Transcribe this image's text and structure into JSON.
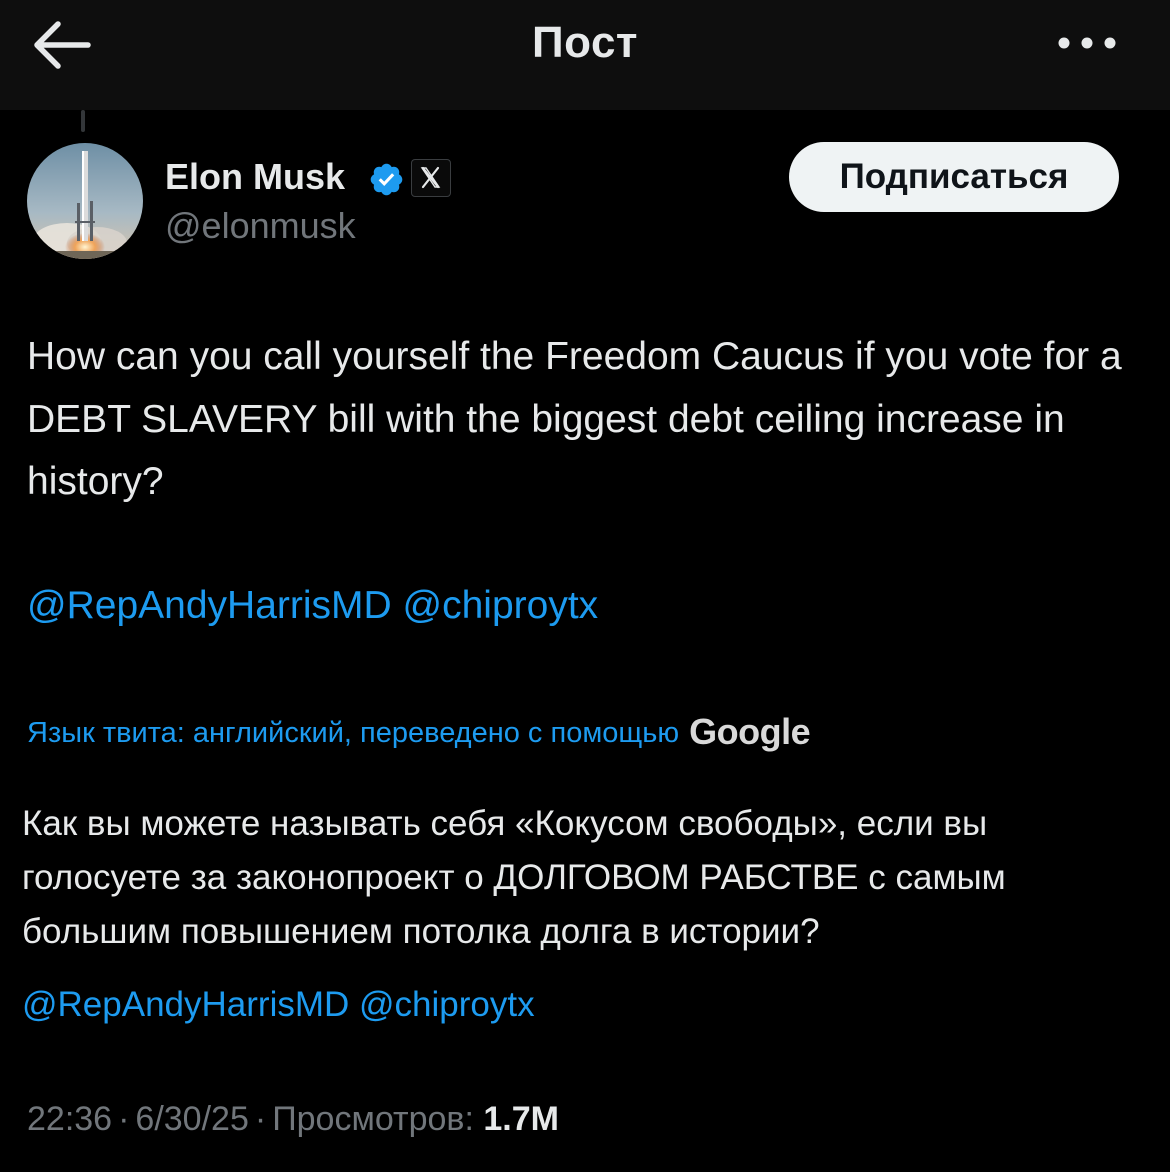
{
  "header": {
    "title": "Пост",
    "back_icon": "arrow-left-icon",
    "more_icon": "more-horizontal-icon"
  },
  "author": {
    "name": "Elon Musk",
    "handle": "@elonmusk",
    "verified": true,
    "affiliate_badge": "x-logo-icon",
    "avatar": "rocket-launch-avatar"
  },
  "follow_button": {
    "label": "Подписаться"
  },
  "tweet": {
    "text": "How can you call yourself the Freedom Caucus if you vote for a DEBT SLAVERY bill with the biggest debt ceiling increase in history?",
    "mentions": [
      "@RepAndyHarrisMD",
      "@chiproytx"
    ]
  },
  "translation": {
    "label": "Язык твита: английский, переведено с помощью",
    "provider": "Google",
    "text": "Как вы можете называть себя «Кокусом свободы», если вы голосуете за законопроект о ДОЛГОВОМ РАБСТВЕ с самым большим повышением потолка долга в истории?",
    "mentions": [
      "@RepAndyHarrisMD",
      "@chiproytx"
    ]
  },
  "meta": {
    "time": "22:36",
    "separator": "·",
    "date": "6/30/25",
    "views_label": "Просмотров:",
    "views_count": "1.7M"
  },
  "colors": {
    "background": "#000000",
    "header_bg": "#0e0e0e",
    "text": "#e7e9ea",
    "secondary": "#71767b",
    "link": "#1d9bf0",
    "verified": "#1d9bf0",
    "button_bg": "#eff3f4"
  }
}
